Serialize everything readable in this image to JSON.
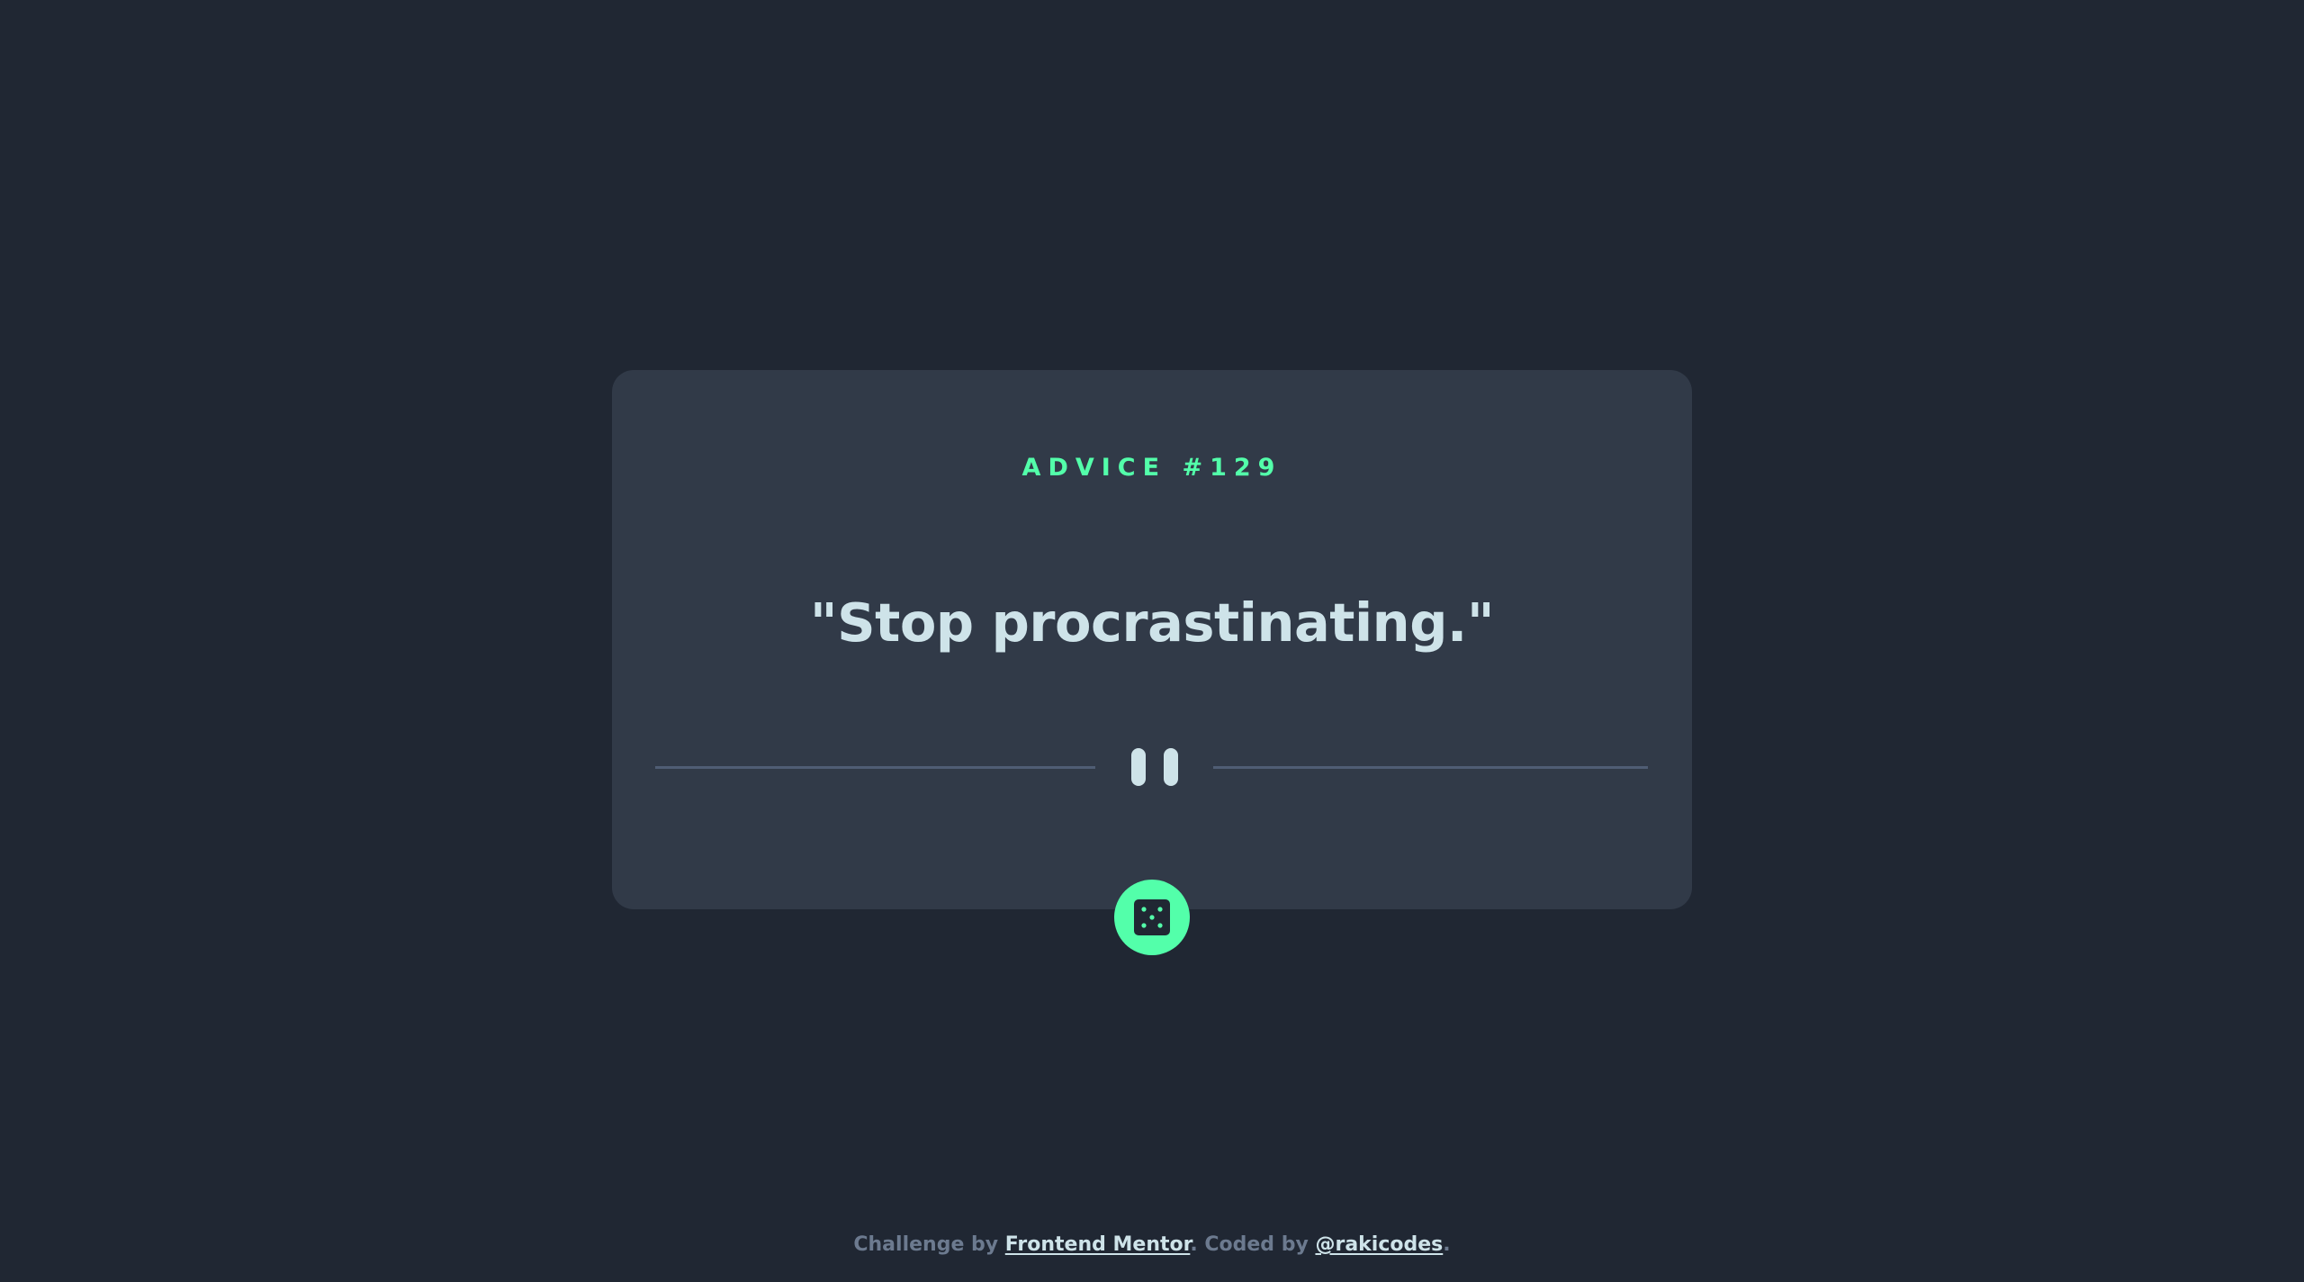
{
  "colors": {
    "background": "#202733",
    "card": "#313a48",
    "accent": "#53ffaa",
    "text": "#cee3e9",
    "divider": "#4f5d74",
    "muted": "#6c7a8f"
  },
  "card": {
    "advice_label": "ADVICE #129",
    "quote": "\"Stop procrastinating.\"",
    "divider_icon": "pause-icon",
    "button_icon": "dice-icon"
  },
  "footer": {
    "prefix": "Challenge by ",
    "challenge_link": "Frontend Mentor",
    "middle": ". Coded by ",
    "author_link": "@rakicodes",
    "suffix": "."
  }
}
